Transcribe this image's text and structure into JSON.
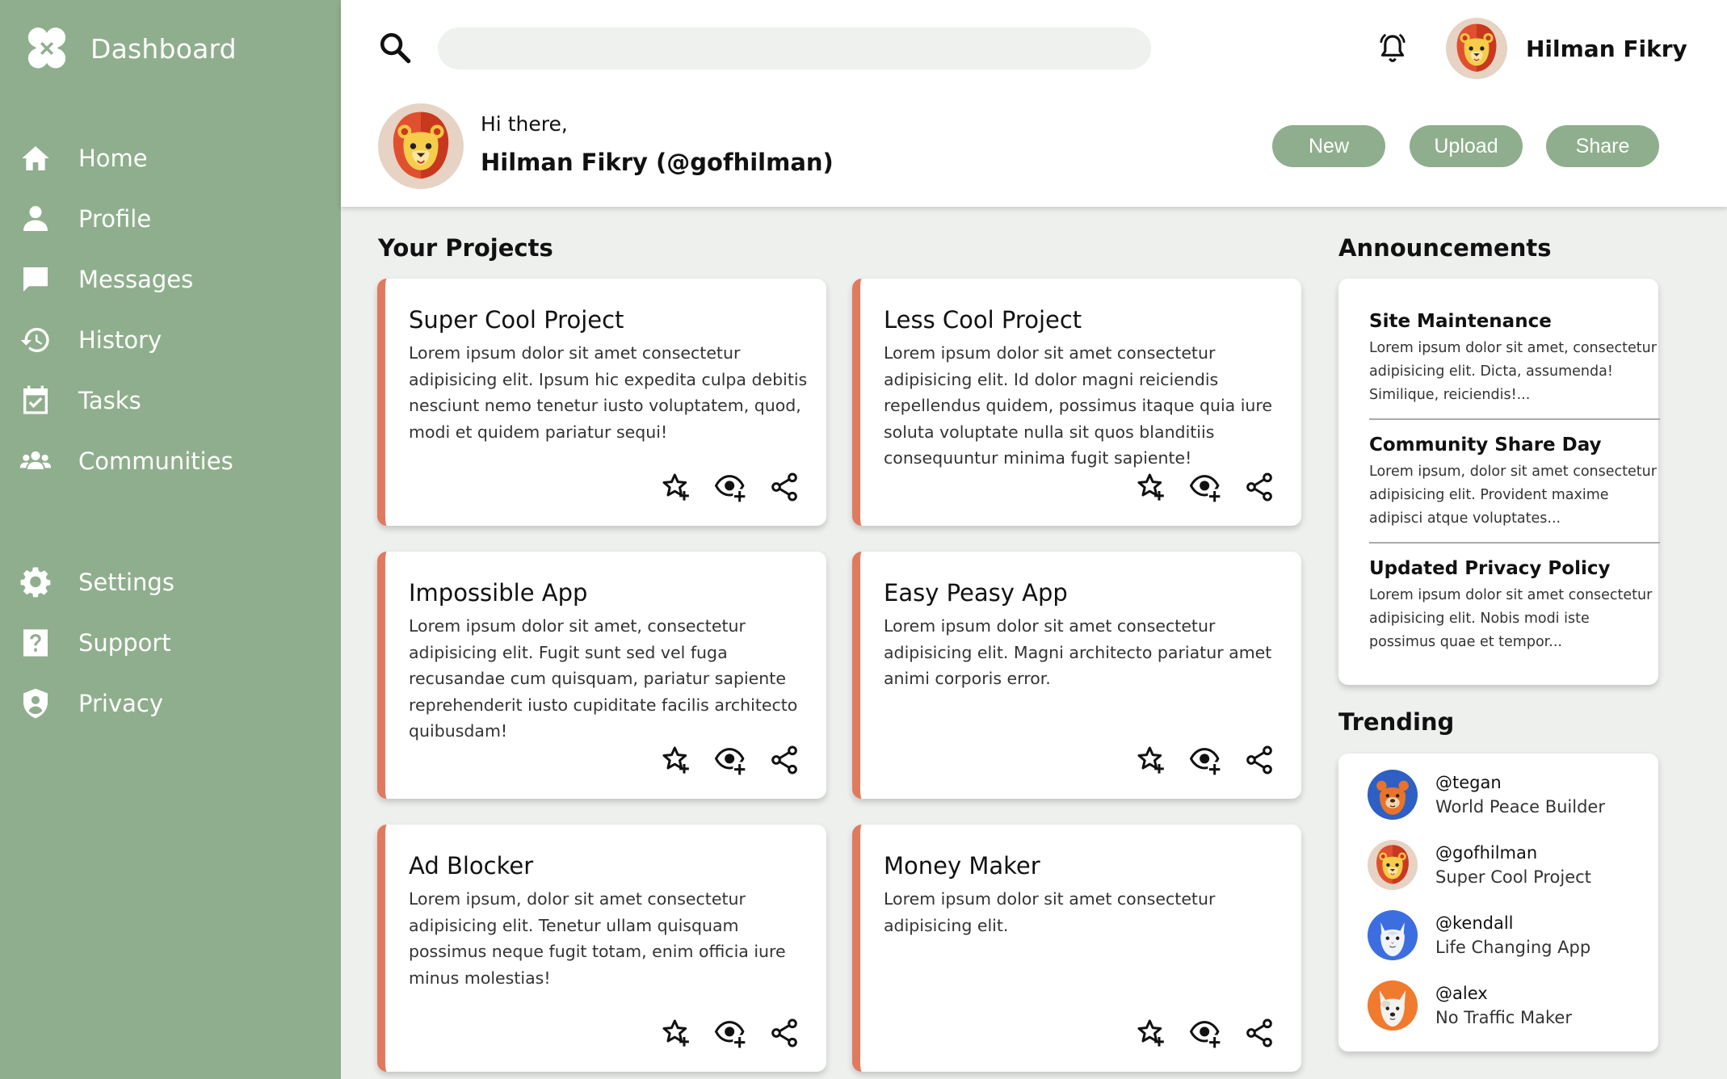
{
  "app": {
    "title": "Dashboard"
  },
  "colors": {
    "sidebar": "#8fae8d",
    "accent": "#e07a5f",
    "background": "#eef0ee"
  },
  "sidebar": {
    "items": [
      {
        "label": "Home",
        "icon": "home-icon"
      },
      {
        "label": "Profile",
        "icon": "user-icon"
      },
      {
        "label": "Messages",
        "icon": "message-icon"
      },
      {
        "label": "History",
        "icon": "history-icon"
      },
      {
        "label": "Tasks",
        "icon": "calendar-check-icon"
      },
      {
        "label": "Communities",
        "icon": "users-icon"
      }
    ],
    "secondary": [
      {
        "label": "Settings",
        "icon": "gear-icon"
      },
      {
        "label": "Support",
        "icon": "help-icon"
      },
      {
        "label": "Privacy",
        "icon": "shield-icon"
      }
    ]
  },
  "header": {
    "search": {
      "value": "",
      "placeholder": ""
    },
    "user_name": "Hilman Fikry",
    "greeting": "Hi there,",
    "greeting_name": "Hilman Fikry (@gofhilman)",
    "buttons": {
      "new": "New",
      "upload": "Upload",
      "share": "Share"
    }
  },
  "projects": {
    "title": "Your Projects",
    "items": [
      {
        "title": "Super Cool Project",
        "desc": "Lorem ipsum dolor sit amet consectetur adipisicing elit. Ipsum hic expedita culpa debitis nesciunt nemo tenetur iusto voluptatem, quod, modi et quidem pariatur sequi!"
      },
      {
        "title": "Less Cool Project",
        "desc": "Lorem ipsum dolor sit amet consectetur adipisicing elit. Id dolor magni reiciendis repellendus quidem, possimus itaque quia iure soluta voluptate nulla sit quos blanditiis consequuntur minima fugit sapiente!"
      },
      {
        "title": "Impossible App",
        "desc": "Lorem ipsum dolor sit amet, consectetur adipisicing elit. Fugit sunt sed vel fuga recusandae cum quisquam, pariatur sapiente reprehenderit iusto cupiditate facilis architecto quibusdam!"
      },
      {
        "title": "Easy Peasy App",
        "desc": "Lorem ipsum dolor sit amet consectetur adipisicing elit. Magni architecto pariatur amet animi corporis error."
      },
      {
        "title": "Ad Blocker",
        "desc": "Lorem ipsum, dolor sit amet consectetur adipisicing elit. Tenetur ullam quisquam possimus neque fugit totam, enim officia iure minus molestias!"
      },
      {
        "title": "Money Maker",
        "desc": "Lorem ipsum dolor sit amet consectetur adipisicing elit."
      }
    ]
  },
  "announcements": {
    "title": "Announcements",
    "items": [
      {
        "title": "Site Maintenance",
        "desc": "Lorem ipsum dolor sit amet, consectetur adipisicing elit. Dicta, assumenda! Similique, reiciendis!..."
      },
      {
        "title": "Community Share Day",
        "desc": "Lorem ipsum, dolor sit amet consectetur adipisicing elit. Provident maxime adipisci atque voluptates..."
      },
      {
        "title": "Updated Privacy Policy",
        "desc": "Lorem ipsum dolor sit amet consectetur adipisicing elit. Nobis modi iste possimus quae et tempor..."
      }
    ]
  },
  "trending": {
    "title": "Trending",
    "items": [
      {
        "handle": "@tegan",
        "project": "World Peace Builder",
        "avatar": "bear-avatar"
      },
      {
        "handle": "@gofhilman",
        "project": "Super Cool Project",
        "avatar": "lion-avatar"
      },
      {
        "handle": "@kendall",
        "project": "Life Changing App",
        "avatar": "cat-avatar"
      },
      {
        "handle": "@alex",
        "project": "No Traffic Maker",
        "avatar": "dog-avatar"
      }
    ]
  }
}
